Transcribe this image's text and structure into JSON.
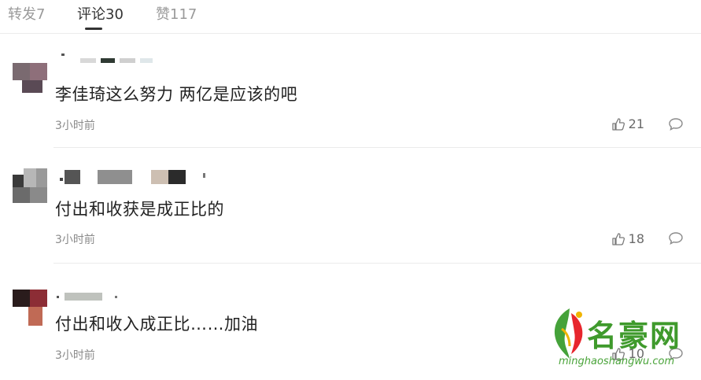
{
  "tabs": [
    {
      "label": "转发7"
    },
    {
      "label": "评论30"
    },
    {
      "label": "赞117"
    }
  ],
  "comments": [
    {
      "content": "李佳琦这么努力 两亿是应该的吧",
      "time": "3小时前",
      "likes": "21"
    },
    {
      "content": "付出和收获是成正比的",
      "time": "3小时前",
      "likes": "18"
    },
    {
      "content": "付出和收入成正比……加油",
      "time": "3小时前",
      "likes": "10"
    }
  ],
  "watermark": {
    "name": "名豪网",
    "url": "minghaoshangwu.com"
  },
  "icons": {
    "like": "thumbs-up-icon",
    "reply": "comment-bubble-icon"
  },
  "colors": {
    "accent_text": "#333333",
    "muted_text": "#9a9a9a",
    "watermark_green": "#3f9a2c"
  }
}
